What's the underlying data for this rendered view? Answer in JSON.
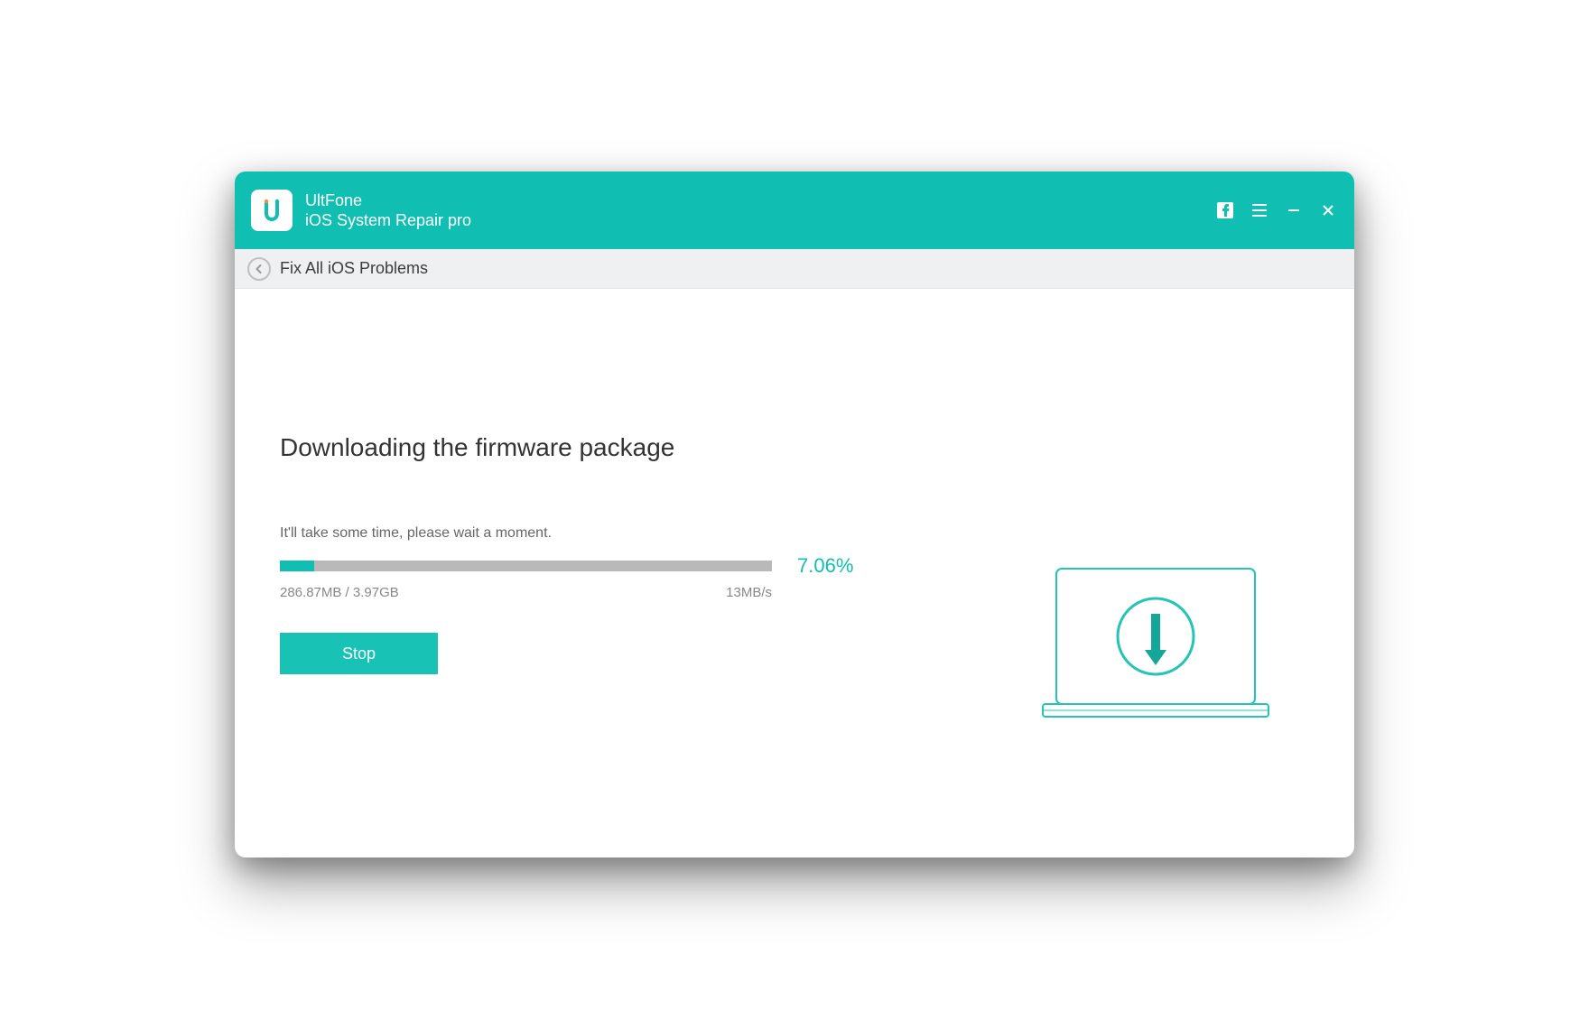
{
  "titlebar": {
    "brand_name": "UltFone",
    "brand_sub": "iOS System Repair pro"
  },
  "breadcrumb": {
    "title": "Fix All iOS Problems"
  },
  "main": {
    "heading": "Downloading the firmware package",
    "subtext": "It'll take some time, please wait a moment.",
    "progress_percent_label": "7.06%",
    "progress_percent_value": 7.06,
    "downloaded_label": "286.87MB / 3.97GB",
    "speed_label": "13MB/s",
    "stop_label": "Stop"
  },
  "colors": {
    "accent": "#10bfb2"
  }
}
